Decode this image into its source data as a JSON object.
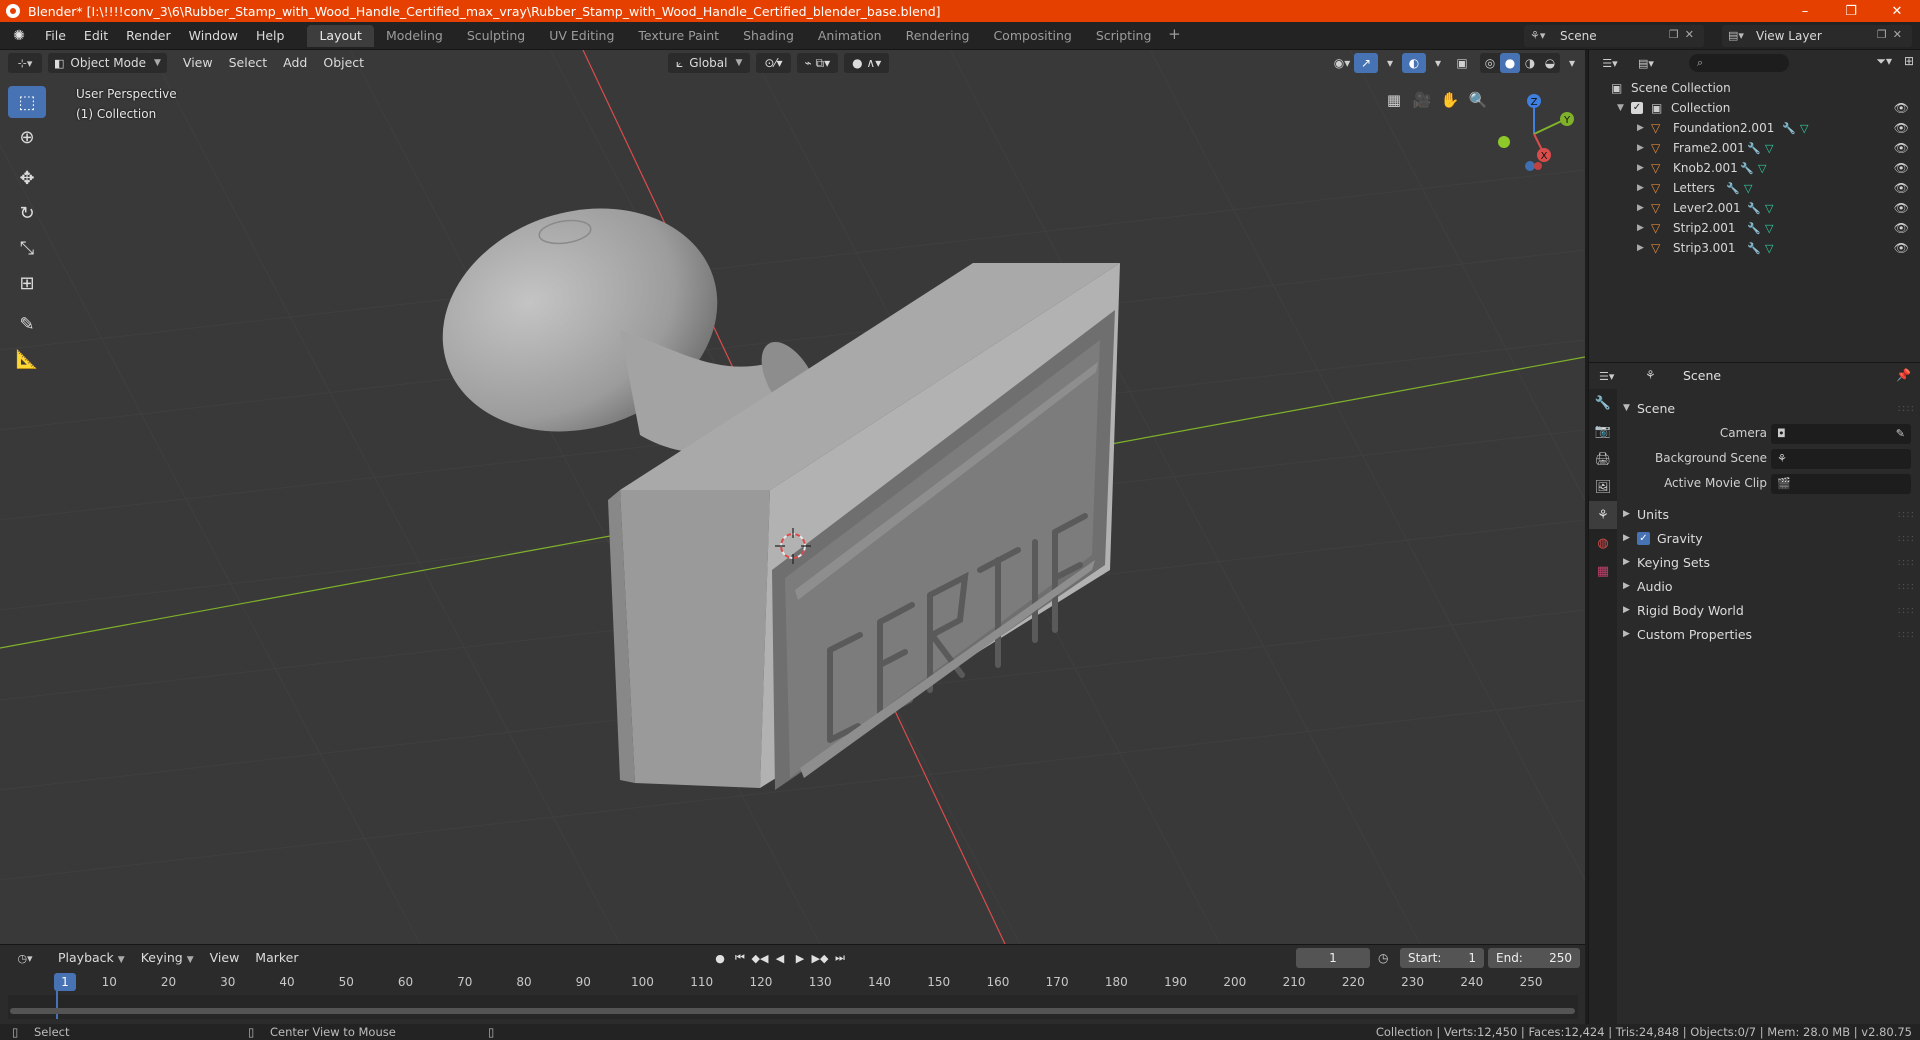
{
  "window": {
    "title": "Blender* [I:\\!!!!conv_3\\6\\Rubber_Stamp_with_Wood_Handle_Certified_max_vray\\Rubber_Stamp_with_Wood_Handle_Certified_blender_base.blend]",
    "minimize": "–",
    "maximize": "❐",
    "close": "✕"
  },
  "menu": [
    "File",
    "Edit",
    "Render",
    "Window",
    "Help"
  ],
  "workspaces": [
    "Layout",
    "Modeling",
    "Sculpting",
    "UV Editing",
    "Texture Paint",
    "Shading",
    "Animation",
    "Rendering",
    "Compositing",
    "Scripting"
  ],
  "active_workspace": "Layout",
  "scene_selector": "Scene",
  "view_layer_selector": "View Layer",
  "viewport": {
    "mode": "Object Mode",
    "menus": [
      "View",
      "Select",
      "Add",
      "Object"
    ],
    "orientation": "Global",
    "perspective_label": "User Perspective",
    "collection_label": "(1) Collection",
    "stamp_text": "CERTIFIED",
    "axis_labels": {
      "x": "X",
      "y": "Y",
      "z": "Z"
    }
  },
  "colors": {
    "accent": "#4772b3",
    "titlebar": "#e64000",
    "x_axis": "#d94c4c",
    "y_axis": "#7fb22a",
    "z_axis": "#3e7fe0",
    "object_icon": "#e08a36"
  },
  "timeline": {
    "menus": [
      "Playback",
      "Keying",
      "View",
      "Marker"
    ],
    "current_frame": "1",
    "start_label": "Start:",
    "start": "1",
    "end_label": "End:",
    "end": "250",
    "ticks": [
      "10",
      "20",
      "30",
      "40",
      "50",
      "60",
      "70",
      "80",
      "90",
      "100",
      "110",
      "120",
      "130",
      "140",
      "150",
      "160",
      "170",
      "180",
      "190",
      "200",
      "210",
      "220",
      "230",
      "240",
      "250"
    ]
  },
  "outliner": {
    "search_icon": "⌕",
    "scene_collection": "Scene Collection",
    "collection": "Collection",
    "objects": [
      "Foundation2.001",
      "Frame2.001",
      "Knob2.001",
      "Letters",
      "Lever2.001",
      "Strip2.001",
      "Strip3.001"
    ]
  },
  "properties": {
    "context": "Scene",
    "panel_title": "Scene",
    "fields": [
      {
        "label": "Camera"
      },
      {
        "label": "Background Scene"
      },
      {
        "label": "Active Movie Clip"
      }
    ],
    "subpanels": [
      "Units",
      "Gravity",
      "Keying Sets",
      "Audio",
      "Rigid Body World",
      "Custom Properties"
    ]
  },
  "statusbar": {
    "left_action": "Select",
    "mid_action": "Center View to Mouse",
    "stats": "Collection | Verts:12,450 | Faces:12,424 | Tris:24,848 | Objects:0/7 | Mem: 28.0 MB | v2.80.75"
  }
}
